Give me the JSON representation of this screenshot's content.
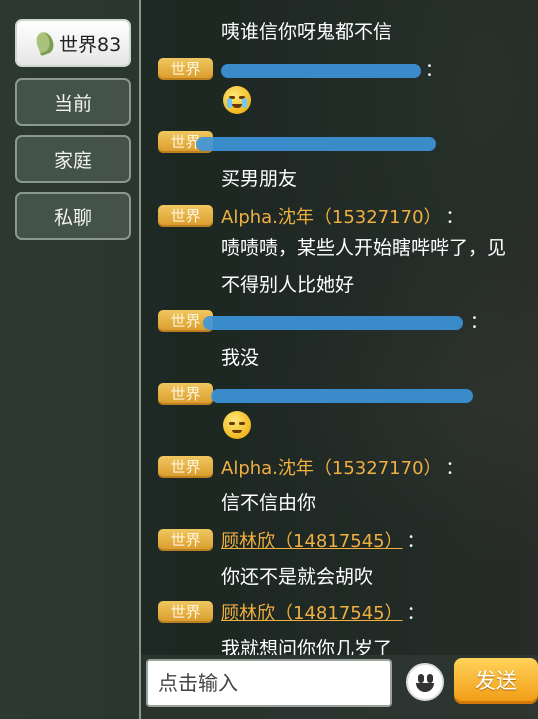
{
  "tabs": [
    {
      "label": "世界83",
      "active": true
    },
    {
      "label": "当前",
      "active": false
    },
    {
      "label": "家庭",
      "active": false
    },
    {
      "label": "私聊",
      "active": false
    }
  ],
  "chat": {
    "top_text": "咦谁信你呀鬼都不信",
    "messages": [
      {
        "channel": "世界",
        "sender": "",
        "text": "",
        "emoji": "crying-face"
      },
      {
        "channel": "世界",
        "sender": "",
        "text": "买男朋友"
      },
      {
        "channel": "世界",
        "sender": "Alpha.沈年（15327170）",
        "text_lines": [
          "啧啧啧，某些人开始瞎哔哔了，见",
          "不得别人比她好"
        ]
      },
      {
        "channel": "世界",
        "sender": "",
        "text": "我没"
      },
      {
        "channel": "世界",
        "sender": "",
        "text": "",
        "emoji": "smirk-face"
      },
      {
        "channel": "世界",
        "sender": "Alpha.沈年（15327170）",
        "text": "信不信由你"
      },
      {
        "channel": "世界",
        "sender": "顾林欣（14817545）",
        "text": "你还不是就会胡吹"
      },
      {
        "channel": "世界",
        "sender": "顾林欣（14817545）",
        "text": "我就想问你你几岁了"
      }
    ],
    "colon": "："
  },
  "composer": {
    "placeholder": "点击输入",
    "send_label": "发送",
    "emoji_icon": "smiley-icon"
  },
  "colors": {
    "badge": "#e0a83a",
    "sender": "#f0b040",
    "send_button": "#f5a623",
    "redaction": "#3c96dc"
  }
}
